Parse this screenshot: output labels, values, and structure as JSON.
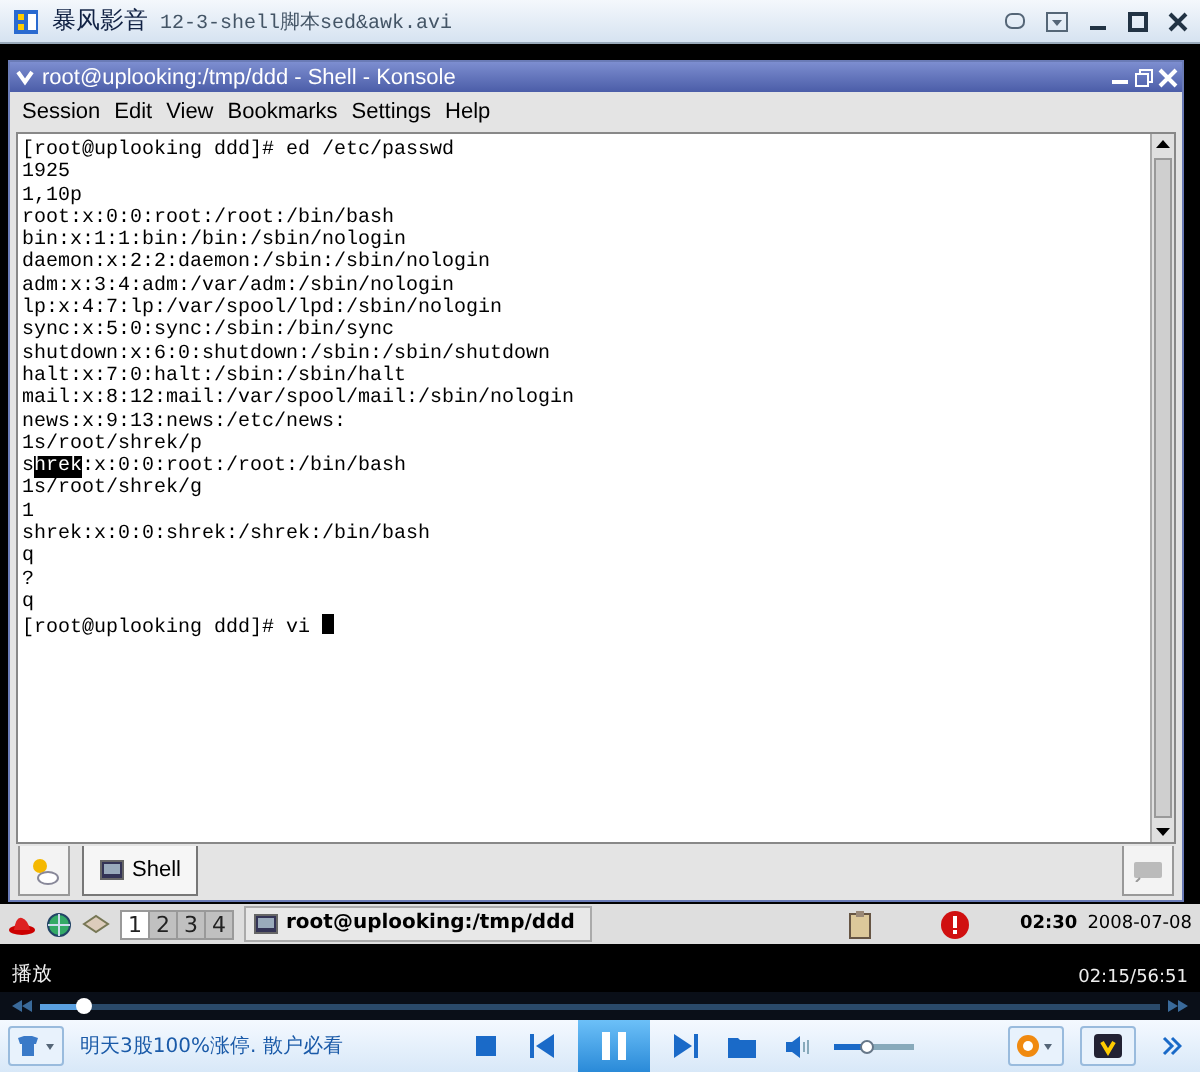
{
  "player": {
    "app_name": "暴风影音",
    "file_name": "12-3-shell脚本sed&awk.avi"
  },
  "konsole": {
    "title": "root@uplooking:/tmp/ddd - Shell - Konsole",
    "menu": [
      "Session",
      "Edit",
      "View",
      "Bookmarks",
      "Settings",
      "Help"
    ],
    "lines": [
      {
        "text": "[root@uplooking ddd]# ed /etc/passwd"
      },
      {
        "text": "1925"
      },
      {
        "text": "1,10p"
      },
      {
        "text": "root:x:0:0:root:/root:/bin/bash"
      },
      {
        "text": "bin:x:1:1:bin:/bin:/sbin/nologin"
      },
      {
        "text": "daemon:x:2:2:daemon:/sbin:/sbin/nologin"
      },
      {
        "text": "adm:x:3:4:adm:/var/adm:/sbin/nologin"
      },
      {
        "text": "lp:x:4:7:lp:/var/spool/lpd:/sbin/nologin"
      },
      {
        "text": "sync:x:5:0:sync:/sbin:/bin/sync"
      },
      {
        "text": "shutdown:x:6:0:shutdown:/sbin:/sbin/shutdown"
      },
      {
        "text": "halt:x:7:0:halt:/sbin:/sbin/halt"
      },
      {
        "text": "mail:x:8:12:mail:/var/spool/mail:/sbin/nologin"
      },
      {
        "text": "news:x:9:13:news:/etc/news:"
      },
      {
        "text": "1s/root/shrek/p"
      },
      {
        "before": "s",
        "selected": "hrek",
        "after": ":x:0:0:root:/root:/bin/bash"
      },
      {
        "text": "1s/root/shrek/g"
      },
      {
        "text": "1"
      },
      {
        "text": "shrek:x:0:0:shrek:/shrek:/bin/bash"
      },
      {
        "text": "q"
      },
      {
        "text": "?"
      },
      {
        "text": "q"
      },
      {
        "text": "[root@uplooking ddd]# vi ",
        "cursor": true
      }
    ],
    "tabs": [
      {
        "label": "Shell",
        "selected": true
      }
    ]
  },
  "panel": {
    "desktops": [
      {
        "label": "1",
        "selected": true
      },
      {
        "label": "2",
        "selected": false
      },
      {
        "label": "3",
        "selected": false
      },
      {
        "label": "4",
        "selected": false
      }
    ],
    "task": "root@uplooking:/tmp/ddd",
    "clock_time": "02:30",
    "clock_date": "2008-07-08"
  },
  "playback": {
    "status": "播放",
    "time": "02:15/56:51",
    "level": 0.04
  },
  "controls": {
    "ad_text": "明天3股100%涨停. 散户必看",
    "pause_selected": true,
    "volume": {
      "level": 0.4
    }
  }
}
